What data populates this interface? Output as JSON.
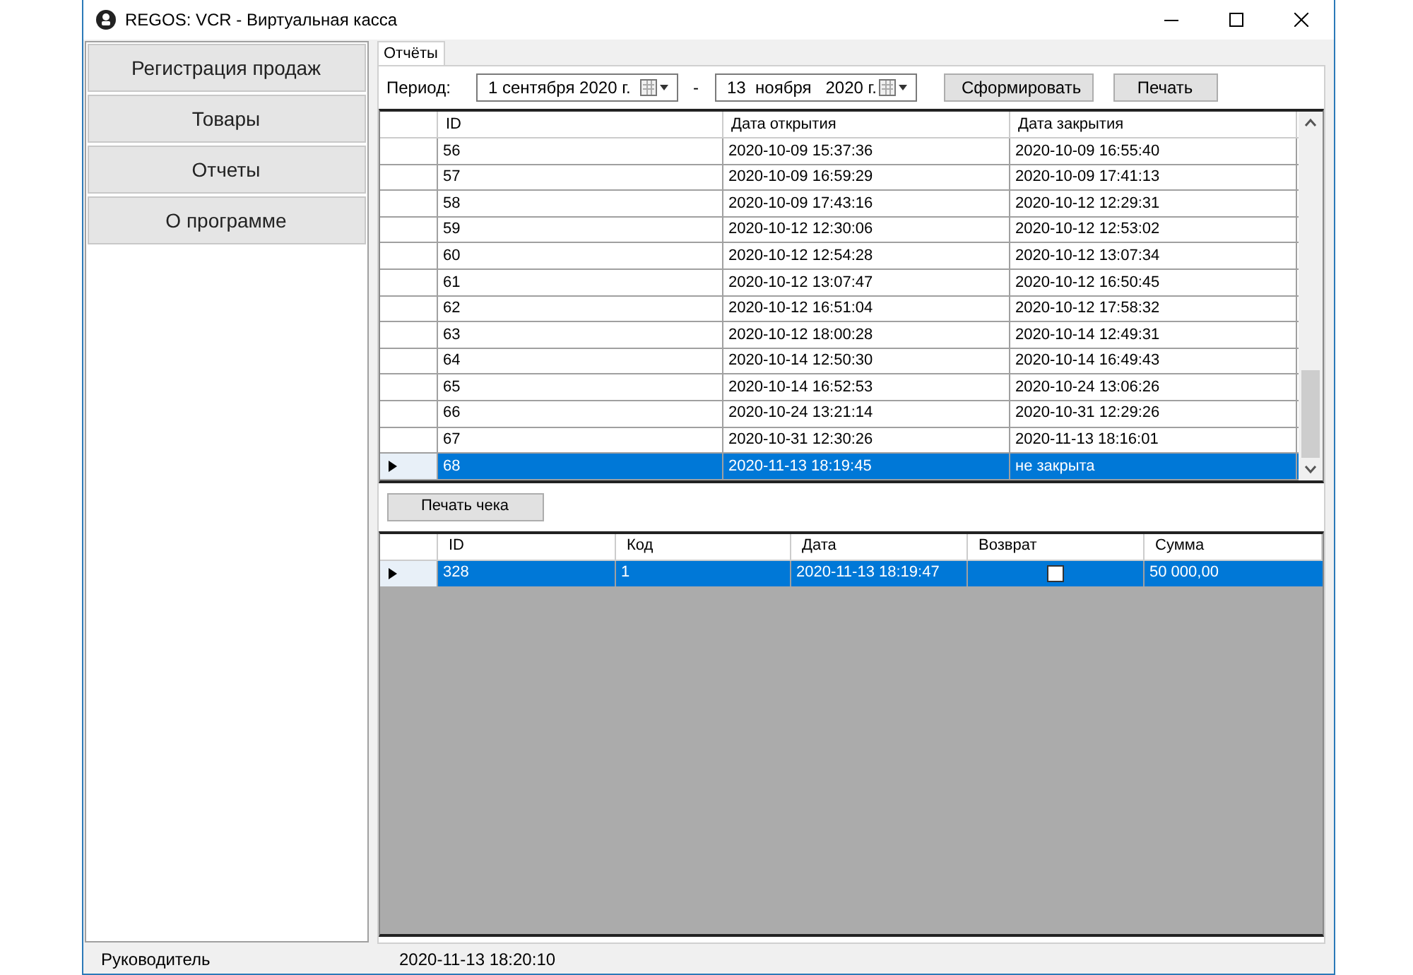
{
  "window": {
    "title": "REGOS: VCR - Виртуальная касса"
  },
  "sidebar": {
    "items": [
      {
        "label": "Регистрация продаж",
        "selected": false
      },
      {
        "label": "Товары",
        "selected": false
      },
      {
        "label": "Отчеты",
        "selected": false
      },
      {
        "label": "О программе",
        "selected": false
      }
    ]
  },
  "tabs": [
    {
      "label": "Отчёты",
      "selected": true
    }
  ],
  "filter": {
    "label": "Период:",
    "from": "1 сентября 2020 г.",
    "separator": "-",
    "to": "13  ноября   2020 г.",
    "buttons": [
      "Сформировать",
      "Печать"
    ]
  },
  "shifts_table": {
    "columns": [
      "ID",
      "Дата открытия",
      "Дата закрытия"
    ],
    "rows": [
      {
        "cells": [
          "56",
          "2020-10-09 15:37:36",
          "2020-10-09 16:55:40"
        ],
        "selected": false
      },
      {
        "cells": [
          "57",
          "2020-10-09 16:59:29",
          "2020-10-09 17:41:13"
        ],
        "selected": false
      },
      {
        "cells": [
          "58",
          "2020-10-09 17:43:16",
          "2020-10-12 12:29:31"
        ],
        "selected": false
      },
      {
        "cells": [
          "59",
          "2020-10-12 12:30:06",
          "2020-10-12 12:53:02"
        ],
        "selected": false
      },
      {
        "cells": [
          "60",
          "2020-10-12 12:54:28",
          "2020-10-12 13:07:34"
        ],
        "selected": false
      },
      {
        "cells": [
          "61",
          "2020-10-12 13:07:47",
          "2020-10-12 16:50:45"
        ],
        "selected": false
      },
      {
        "cells": [
          "62",
          "2020-10-12 16:51:04",
          "2020-10-12 17:58:32"
        ],
        "selected": false
      },
      {
        "cells": [
          "63",
          "2020-10-12 18:00:28",
          "2020-10-14 12:49:31"
        ],
        "selected": false
      },
      {
        "cells": [
          "64",
          "2020-10-14 12:50:30",
          "2020-10-14 16:49:43"
        ],
        "selected": false
      },
      {
        "cells": [
          "65",
          "2020-10-14 16:52:53",
          "2020-10-24 13:06:26"
        ],
        "selected": false
      },
      {
        "cells": [
          "66",
          "2020-10-24 13:21:14",
          "2020-10-31 12:29:26"
        ],
        "selected": false
      },
      {
        "cells": [
          "67",
          "2020-10-31 12:30:26",
          "2020-11-13 18:16:01"
        ],
        "selected": false
      },
      {
        "cells": [
          "68",
          "2020-11-13 18:19:45",
          "не закрыта"
        ],
        "selected": true
      }
    ]
  },
  "print_receipt_button": "Печать чека",
  "receipts_table": {
    "columns": [
      "ID",
      "Код",
      "Дата",
      "Возврат",
      "Сумма"
    ],
    "rows": [
      {
        "id": "328",
        "code": "1",
        "date": "2020-11-13 18:19:47",
        "refund": false,
        "sum": "50 000,00",
        "selected": true
      }
    ]
  },
  "status_bar": {
    "user": "Руководитель",
    "time": "2020-11-13 18:20:10"
  }
}
